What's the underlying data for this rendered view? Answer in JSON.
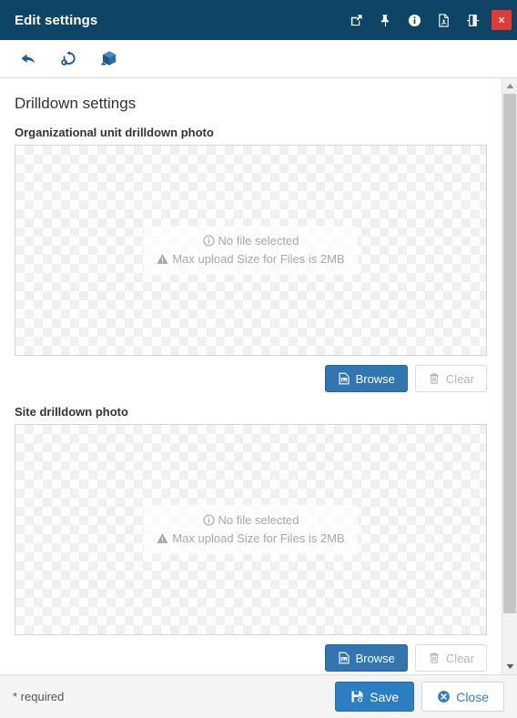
{
  "window": {
    "title": "Edit settings",
    "titlebar_icons": [
      {
        "name": "popout-icon",
        "label": "Open in new window"
      },
      {
        "name": "pin-icon",
        "label": "Pin"
      },
      {
        "name": "info-icon",
        "label": "Info"
      },
      {
        "name": "pdf-icon",
        "label": "Export PDF"
      },
      {
        "name": "toggle-panel-icon",
        "label": "Toggle panel"
      }
    ],
    "close_label": "×"
  },
  "toolbar": {
    "items": [
      {
        "name": "back-icon",
        "label": "Back"
      },
      {
        "name": "revert-history-icon",
        "label": "Revert"
      },
      {
        "name": "package-cube-icon",
        "label": "Package"
      }
    ]
  },
  "main": {
    "section_title": "Drilldown settings",
    "uploads": [
      {
        "label": "Organizational unit drilldown photo",
        "no_file_text": "No file selected",
        "max_size_text": "Max upload Size for Files is 2MB",
        "browse_label": "Browse",
        "clear_label": "Clear"
      },
      {
        "label": "Site drilldown photo",
        "no_file_text": "No file selected",
        "max_size_text": "Max upload Size for Files is 2MB",
        "browse_label": "Browse",
        "clear_label": "Clear"
      }
    ]
  },
  "footer": {
    "required_note": "* required",
    "save_label": "Save",
    "close_label": "Close"
  },
  "colors": {
    "titlebar_bg": "#0e4466",
    "close_btn_bg": "#e13c32",
    "primary_btn_bg": "#3276b1",
    "footer_primary_bg": "#2b7dc4",
    "toolbar_icon": "#1c5b96",
    "placeholder_text": "#a8a8a8"
  }
}
